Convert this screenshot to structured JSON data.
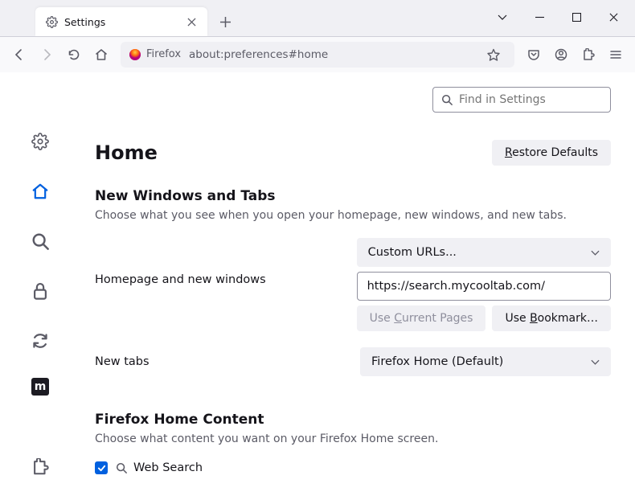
{
  "window": {
    "tab_title": "Settings"
  },
  "urlbar": {
    "identity": "Firefox",
    "address": "about:preferences#home"
  },
  "search": {
    "placeholder": "Find in Settings"
  },
  "page": {
    "title": "Home",
    "restore_btn": "Restore Defaults"
  },
  "section1": {
    "title": "New Windows and Tabs",
    "desc": "Choose what you see when you open your homepage, new windows, and new tabs.",
    "homepage_label": "Homepage and new windows",
    "homepage_select": "Custom URLs...",
    "homepage_url": "https://search.mycooltab.com/",
    "use_current": "Use Current Pages",
    "use_bookmark": "Use Bookmark…",
    "newtabs_label": "New tabs",
    "newtabs_select": "Firefox Home (Default)"
  },
  "section2": {
    "title": "Firefox Home Content",
    "desc": "Choose what content you want on your Firefox Home screen.",
    "web_search": "Web Search"
  }
}
